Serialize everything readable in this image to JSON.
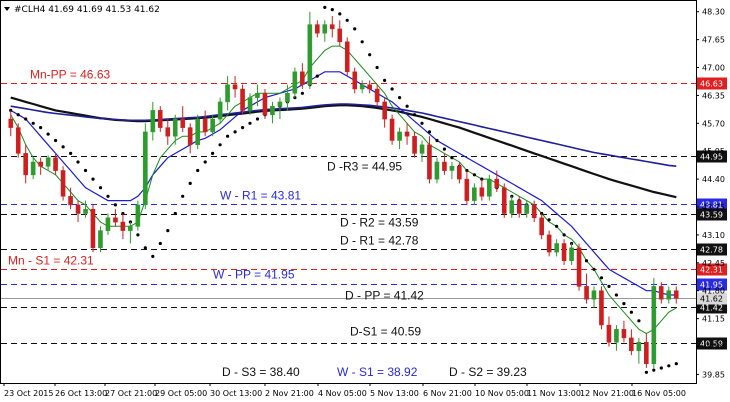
{
  "header": {
    "label": "#CLH4  41.69 41.69 41.53 41.62"
  },
  "colors": {
    "background": "#ffffff",
    "bull_candle": "#2e9b2e",
    "bear_candle": "#cc2020",
    "fast_ma": "#1a8c1a",
    "mid_ma": "#1a1ad8",
    "slow_ma": "#111111",
    "slow_ma2": "#1f1f99",
    "daily_level": "#111111",
    "weekly_level": "#2a2ae0",
    "monthly_level": "#e02020",
    "sar": "#000000"
  },
  "chart_data": {
    "type": "candlestick",
    "symbol": "#CLH4",
    "timeframe": "H4",
    "ylim": [
      39.65,
      48.55
    ],
    "y_ticks": [
      "48.30",
      "47.65",
      "47.00",
      "46.35",
      "45.70",
      "45.05",
      "44.40",
      "43.75",
      "43.10",
      "42.45",
      "41.80",
      "41.15",
      "40.50",
      "39.85"
    ],
    "x_ticks": [
      "23 Oct 2015",
      "26 Oct 13:00",
      "27 Oct 21:00",
      "29 Oct 05:00",
      "30 Oct 13:00",
      "2 Nov 21:00",
      "4 Nov 05:00",
      "5 Nov 13:00",
      "6 Nov 21:00",
      "10 Nov 05:00",
      "11 Nov 13:00",
      "12 Nov 21:00",
      "16 Nov 05:00"
    ],
    "levels": [
      {
        "label": "Mn-PP = 46.63",
        "tag": "46.63",
        "value": 46.63,
        "group": "monthly",
        "style": "dashed"
      },
      {
        "label": "D -R3 = 44.95",
        "tag": "44.95",
        "value": 44.95,
        "group": "daily",
        "style": "dashed"
      },
      {
        "label": "W - R1 = 43.81",
        "tag": "43.81",
        "value": 43.81,
        "group": "weekly",
        "style": "dashed"
      },
      {
        "label": "D - R2 = 43.59",
        "tag": "43.59",
        "value": 43.59,
        "group": "daily",
        "style": "dashed"
      },
      {
        "label": "D - R1 = 42.78",
        "tag": "42.78",
        "value": 42.78,
        "group": "daily",
        "style": "dashed"
      },
      {
        "label": "Mn - S1 = 42.31",
        "tag": "42.31",
        "value": 42.31,
        "group": "monthly",
        "style": "dashed"
      },
      {
        "label": "W - PP = 41.95",
        "tag": "41.95",
        "value": 41.95,
        "group": "weekly",
        "style": "dashed"
      },
      {
        "label": "D - PP = 41.42",
        "tag": "41.42",
        "value": 41.42,
        "group": "daily",
        "style": "dashed"
      },
      {
        "label": "D-S1 = 40.59",
        "tag": "40.59",
        "value": 40.59,
        "group": "daily",
        "style": "dashed"
      },
      {
        "label": "D - S3 = 38.40",
        "tag": "",
        "value": null,
        "group": "daily",
        "style": "label-only"
      },
      {
        "label": "W - S1 = 38.92",
        "tag": "",
        "value": null,
        "group": "weekly",
        "style": "label-only"
      },
      {
        "label": "D - S2 = 39.23",
        "tag": "",
        "value": null,
        "group": "daily",
        "style": "label-only"
      }
    ],
    "current_price": {
      "tag": "41.62",
      "value": 41.62
    },
    "candles": [
      [
        45.8,
        46.0,
        45.4,
        45.6
      ],
      [
        45.6,
        45.7,
        44.9,
        45.0
      ],
      [
        45.0,
        45.2,
        44.3,
        44.5
      ],
      [
        44.5,
        44.9,
        44.4,
        44.8
      ],
      [
        44.8,
        44.9,
        44.5,
        44.7
      ],
      [
        44.7,
        44.95,
        44.6,
        44.9
      ],
      [
        44.9,
        45.0,
        44.5,
        44.6
      ],
      [
        44.6,
        44.7,
        43.9,
        44.0
      ],
      [
        44.0,
        44.2,
        43.7,
        43.8
      ],
      [
        43.8,
        43.9,
        43.4,
        43.6
      ],
      [
        43.6,
        43.9,
        43.5,
        43.7
      ],
      [
        43.7,
        43.8,
        42.7,
        42.8
      ],
      [
        42.8,
        43.3,
        42.7,
        43.2
      ],
      [
        43.2,
        43.6,
        43.1,
        43.5
      ],
      [
        43.5,
        43.7,
        43.3,
        43.4
      ],
      [
        43.4,
        43.6,
        43.0,
        43.2
      ],
      [
        43.2,
        43.4,
        42.9,
        43.3
      ],
      [
        43.3,
        43.9,
        43.2,
        43.8
      ],
      [
        43.8,
        45.7,
        43.7,
        45.5
      ],
      [
        45.5,
        46.2,
        45.3,
        46.0
      ],
      [
        46.0,
        46.1,
        45.5,
        45.6
      ],
      [
        45.6,
        45.8,
        45.2,
        45.4
      ],
      [
        45.4,
        45.9,
        45.2,
        45.8
      ],
      [
        45.8,
        46.1,
        45.5,
        45.6
      ],
      [
        45.6,
        45.7,
        45.0,
        45.2
      ],
      [
        45.2,
        45.9,
        45.1,
        45.8
      ],
      [
        45.8,
        46.0,
        45.4,
        45.5
      ],
      [
        45.5,
        45.9,
        45.4,
        45.8
      ],
      [
        45.8,
        46.3,
        45.7,
        46.2
      ],
      [
        46.2,
        46.8,
        46.0,
        46.6
      ],
      [
        46.6,
        46.8,
        46.3,
        46.5
      ],
      [
        46.5,
        46.6,
        45.9,
        46.0
      ],
      [
        46.0,
        46.4,
        45.9,
        46.3
      ],
      [
        46.3,
        46.6,
        46.1,
        46.4
      ],
      [
        46.4,
        46.5,
        45.8,
        45.9
      ],
      [
        45.9,
        46.2,
        45.7,
        46.1
      ],
      [
        46.1,
        46.3,
        45.8,
        46.2
      ],
      [
        46.2,
        46.6,
        46.0,
        46.4
      ],
      [
        46.4,
        47.0,
        46.3,
        46.9
      ],
      [
        46.9,
        47.1,
        46.5,
        46.6
      ],
      [
        46.6,
        48.3,
        46.5,
        48.0
      ],
      [
        48.0,
        48.1,
        47.7,
        47.8
      ],
      [
        47.8,
        48.1,
        47.6,
        48.0
      ],
      [
        48.0,
        48.2,
        47.7,
        47.9
      ],
      [
        47.9,
        48.1,
        47.5,
        47.6
      ],
      [
        47.6,
        47.7,
        46.8,
        46.9
      ],
      [
        46.9,
        47.0,
        46.4,
        46.5
      ],
      [
        46.5,
        46.7,
        46.4,
        46.6
      ],
      [
        46.6,
        46.7,
        46.4,
        46.5
      ],
      [
        46.5,
        46.6,
        46.1,
        46.2
      ],
      [
        46.2,
        46.3,
        45.6,
        45.8
      ],
      [
        45.8,
        45.9,
        45.2,
        45.3
      ],
      [
        45.3,
        45.6,
        45.1,
        45.5
      ],
      [
        45.5,
        45.7,
        45.2,
        45.4
      ],
      [
        45.4,
        45.5,
        44.9,
        45.0
      ],
      [
        45.0,
        45.3,
        44.8,
        45.2
      ],
      [
        45.2,
        45.4,
        44.3,
        44.4
      ],
      [
        44.4,
        44.9,
        44.3,
        44.8
      ],
      [
        44.8,
        45.0,
        44.5,
        44.6
      ],
      [
        44.6,
        44.8,
        44.4,
        44.7
      ],
      [
        44.7,
        44.8,
        44.3,
        44.4
      ],
      [
        44.4,
        44.6,
        43.8,
        43.9
      ],
      [
        43.9,
        44.3,
        43.8,
        44.2
      ],
      [
        44.2,
        44.4,
        43.9,
        44.0
      ],
      [
        44.0,
        44.5,
        43.9,
        44.4
      ],
      [
        44.4,
        44.6,
        44.1,
        44.2
      ],
      [
        44.2,
        44.3,
        43.5,
        43.6
      ],
      [
        43.6,
        44.0,
        43.5,
        43.9
      ],
      [
        43.9,
        44.0,
        43.5,
        43.6
      ],
      [
        43.6,
        43.9,
        43.5,
        43.8
      ],
      [
        43.8,
        43.9,
        43.4,
        43.5
      ],
      [
        43.5,
        43.6,
        43.0,
        43.1
      ],
      [
        43.1,
        43.2,
        42.6,
        42.7
      ],
      [
        42.7,
        43.0,
        42.6,
        42.9
      ],
      [
        42.9,
        43.0,
        42.4,
        42.5
      ],
      [
        42.5,
        42.9,
        42.4,
        42.8
      ],
      [
        42.8,
        42.9,
        41.8,
        41.9
      ],
      [
        41.9,
        42.2,
        41.5,
        41.6
      ],
      [
        41.6,
        41.9,
        41.4,
        41.8
      ],
      [
        41.8,
        41.9,
        40.9,
        41.0
      ],
      [
        41.0,
        41.2,
        40.5,
        40.6
      ],
      [
        40.6,
        41.0,
        40.4,
        40.9
      ],
      [
        40.9,
        41.1,
        40.6,
        40.7
      ],
      [
        40.7,
        40.9,
        40.3,
        40.4
      ],
      [
        40.4,
        40.7,
        40.1,
        40.6
      ],
      [
        40.6,
        40.8,
        40.0,
        40.1
      ],
      [
        40.1,
        42.1,
        40.0,
        41.9
      ],
      [
        41.9,
        42.0,
        41.5,
        41.6
      ],
      [
        41.6,
        41.9,
        41.5,
        41.8
      ],
      [
        41.8,
        41.9,
        41.5,
        41.62
      ]
    ],
    "fast_ma_values": [
      45.9,
      45.6,
      45.2,
      44.9,
      44.7,
      44.6,
      44.5,
      44.3,
      44.1,
      43.9,
      43.8,
      43.6,
      43.4,
      43.3,
      43.3,
      43.3,
      43.3,
      43.4,
      43.9,
      44.5,
      44.9,
      45.1,
      45.3,
      45.4,
      45.4,
      45.5,
      45.5,
      45.6,
      45.7,
      45.9,
      46.1,
      46.2,
      46.3,
      46.4,
      46.4,
      46.4,
      46.4,
      46.5,
      46.6,
      46.7,
      47.0,
      47.2,
      47.4,
      47.5,
      47.5,
      47.4,
      47.2,
      47.0,
      46.8,
      46.6,
      46.4,
      46.1,
      45.9,
      45.7,
      45.5,
      45.4,
      45.2,
      45.1,
      45.0,
      44.9,
      44.8,
      44.6,
      44.5,
      44.4,
      44.4,
      44.3,
      44.2,
      44.1,
      44.0,
      43.9,
      43.8,
      43.6,
      43.4,
      43.3,
      43.1,
      43.0,
      42.8,
      42.5,
      42.3,
      42.0,
      41.7,
      41.5,
      41.3,
      41.1,
      40.9,
      40.8,
      40.9,
      41.1,
      41.3,
      41.4
    ],
    "mid_ma_values": [
      46.0,
      45.9,
      45.8,
      45.6,
      45.4,
      45.2,
      45.0,
      44.8,
      44.6,
      44.4,
      44.2,
      44.1,
      44.0,
      43.9,
      43.9,
      43.9,
      43.9,
      44.0,
      44.2,
      44.5,
      44.7,
      44.9,
      45.0,
      45.1,
      45.2,
      45.3,
      45.35,
      45.45,
      45.55,
      45.7,
      45.85,
      46.0,
      46.1,
      46.2,
      46.3,
      46.35,
      46.4,
      46.45,
      46.5,
      46.6,
      46.7,
      46.8,
      46.9,
      46.9,
      46.9,
      46.8,
      46.7,
      46.6,
      46.5,
      46.4,
      46.3,
      46.2,
      46.05,
      45.9,
      45.75,
      45.6,
      45.45,
      45.3,
      45.2,
      45.1,
      45.0,
      44.9,
      44.8,
      44.7,
      44.6,
      44.5,
      44.4,
      44.3,
      44.2,
      44.1,
      44.0,
      43.9,
      43.75,
      43.6,
      43.45,
      43.3,
      43.1,
      42.9,
      42.7,
      42.5,
      42.3,
      42.2,
      42.1,
      42.0,
      41.9,
      41.8,
      41.8,
      41.75,
      41.7,
      41.7
    ],
    "slow_ma_values": [
      46.3,
      46.25,
      46.2,
      46.15,
      46.1,
      46.05,
      46.0,
      45.97,
      45.94,
      45.91,
      45.88,
      45.85,
      45.82,
      45.8,
      45.78,
      45.77,
      45.76,
      45.75,
      45.75,
      45.76,
      45.77,
      45.78,
      45.79,
      45.8,
      45.81,
      45.82,
      45.83,
      45.85,
      45.87,
      45.89,
      45.91,
      45.93,
      45.95,
      45.97,
      45.99,
      46.0,
      46.01,
      46.02,
      46.03,
      46.04,
      46.06,
      46.08,
      46.1,
      46.11,
      46.12,
      46.12,
      46.11,
      46.1,
      46.08,
      46.06,
      46.03,
      46.0,
      45.97,
      45.93,
      45.89,
      45.85,
      45.8,
      45.75,
      45.7,
      45.65,
      45.6,
      45.54,
      45.48,
      45.42,
      45.36,
      45.3,
      45.24,
      45.18,
      45.12,
      45.06,
      45.0,
      44.94,
      44.88,
      44.82,
      44.76,
      44.7,
      44.64,
      44.58,
      44.52,
      44.46,
      44.4,
      44.35,
      44.3,
      44.25,
      44.2,
      44.15,
      44.1,
      44.06,
      44.02,
      43.98
    ],
    "slow_ma2_values": [
      46.1,
      46.07,
      46.04,
      46.01,
      45.98,
      45.95,
      45.93,
      45.91,
      45.89,
      45.87,
      45.85,
      45.83,
      45.81,
      45.8,
      45.79,
      45.78,
      45.77,
      45.77,
      45.77,
      45.78,
      45.79,
      45.8,
      45.81,
      45.82,
      45.83,
      45.84,
      45.86,
      45.88,
      45.9,
      45.92,
      45.94,
      45.96,
      45.98,
      46.0,
      46.02,
      46.03,
      46.04,
      46.05,
      46.06,
      46.07,
      46.09,
      46.11,
      46.13,
      46.14,
      46.15,
      46.15,
      46.14,
      46.13,
      46.12,
      46.1,
      46.08,
      46.06,
      46.03,
      46.0,
      45.97,
      45.94,
      45.9,
      45.86,
      45.82,
      45.78,
      45.74,
      45.7,
      45.66,
      45.62,
      45.58,
      45.54,
      45.5,
      45.46,
      45.42,
      45.38,
      45.34,
      45.3,
      45.26,
      45.22,
      45.18,
      45.14,
      45.1,
      45.06,
      45.02,
      44.99,
      44.96,
      44.93,
      44.9,
      44.87,
      44.84,
      44.81,
      44.78,
      44.75,
      44.72,
      44.7
    ],
    "sar_values": [
      46.0,
      45.9,
      45.8,
      45.7,
      45.6,
      45.45,
      45.3,
      45.15,
      45.0,
      44.8,
      44.6,
      44.4,
      44.2,
      44.0,
      43.8,
      43.6,
      43.4,
      43.1,
      42.8,
      42.6,
      42.9,
      43.2,
      43.6,
      44.0,
      44.3,
      44.6,
      44.8,
      45.0,
      45.2,
      45.4,
      45.5,
      45.6,
      45.7,
      45.8,
      45.9,
      46.0,
      46.1,
      46.2,
      46.3,
      46.4,
      46.6,
      46.8,
      48.4,
      48.35,
      48.25,
      48.1,
      47.9,
      47.6,
      47.3,
      47.0,
      46.7,
      46.5,
      46.3,
      46.1,
      45.9,
      45.7,
      45.5,
      45.3,
      45.1,
      44.9,
      44.7,
      44.6,
      44.5,
      44.4,
      44.3,
      44.2,
      44.1,
      44.0,
      43.9,
      43.8,
      43.7,
      43.6,
      43.45,
      43.3,
      43.1,
      42.9,
      42.7,
      42.5,
      42.3,
      42.1,
      41.9,
      41.7,
      41.5,
      41.3,
      41.1,
      39.9,
      39.95,
      40.0,
      40.05,
      40.1
    ]
  }
}
